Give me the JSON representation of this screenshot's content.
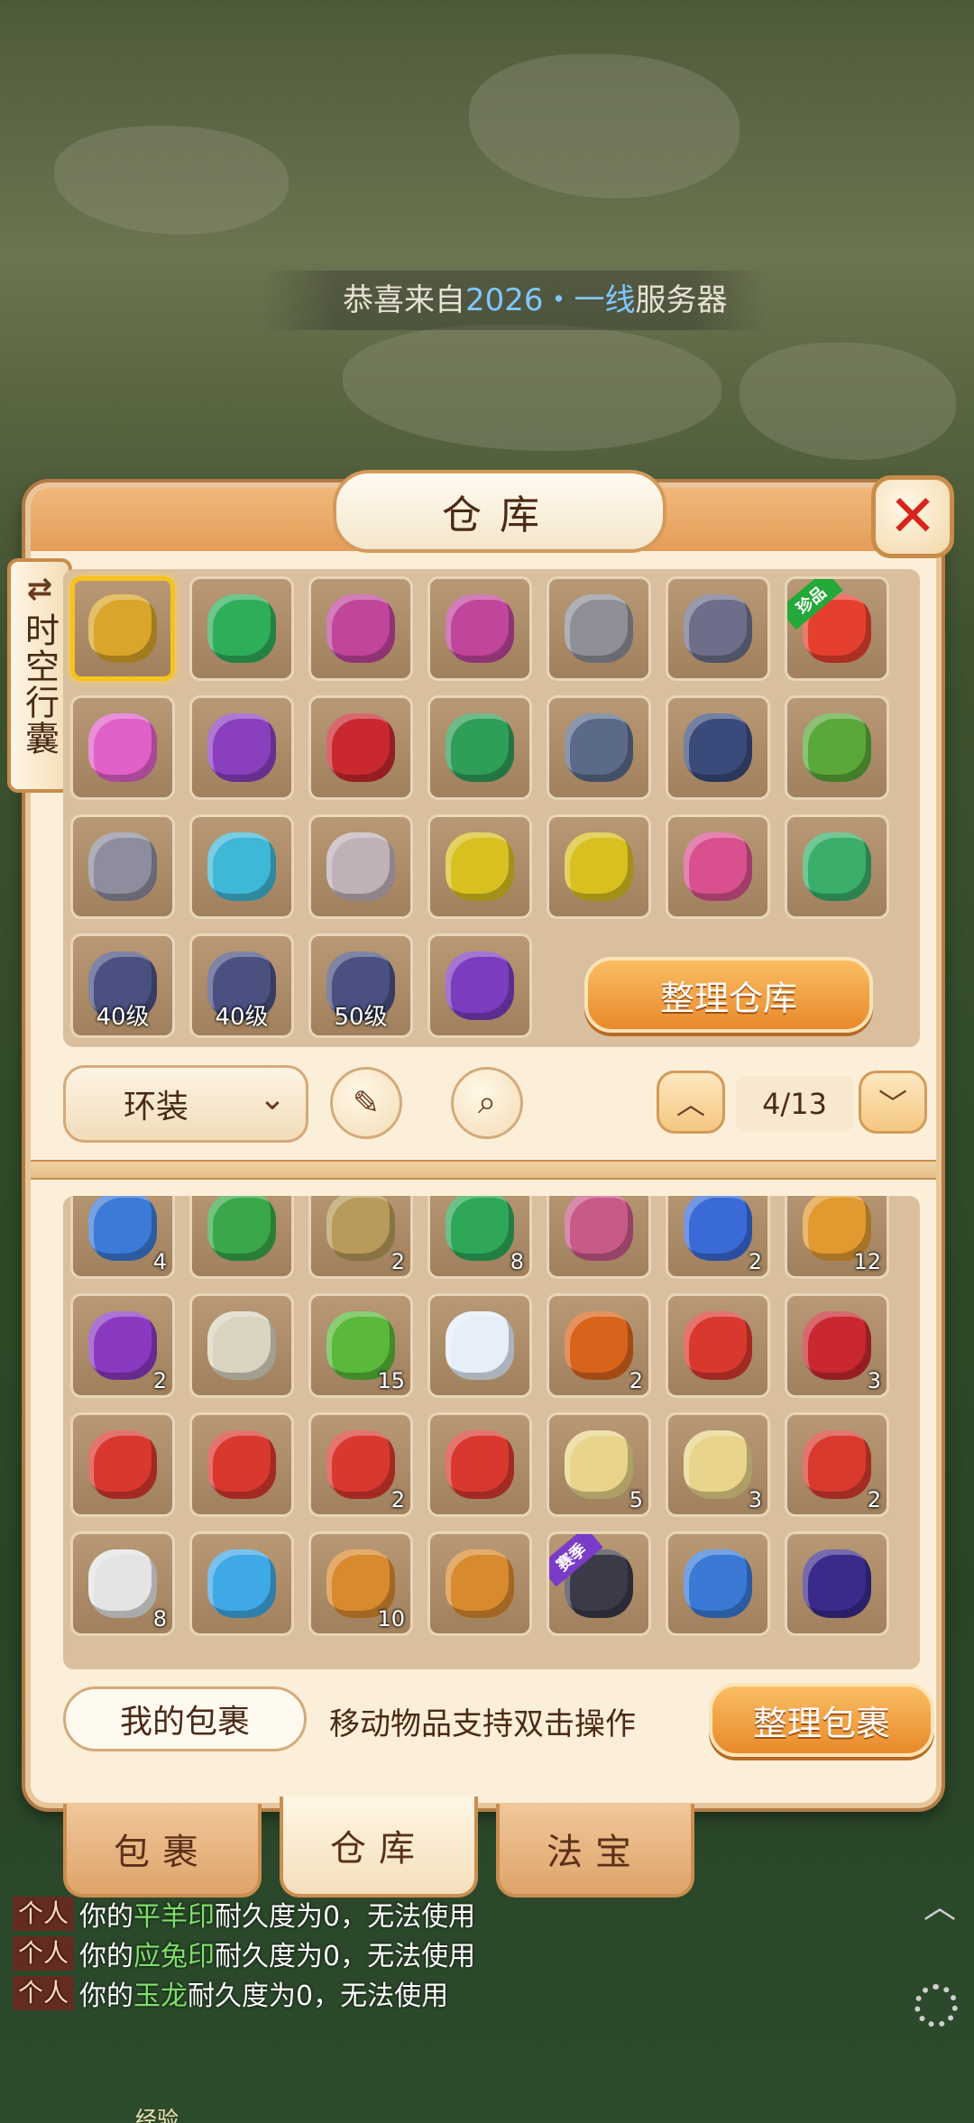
{
  "marquee": {
    "prefix": "恭喜来自",
    "highlight": "2026・一线",
    "suffix": "服务器"
  },
  "panel": {
    "title": "仓库",
    "close_glyph": "✕",
    "side_tab": {
      "icon": "⇄",
      "label": "时空行囊"
    }
  },
  "warehouse": {
    "items": [
      {
        "color": "#d9a52a",
        "selected": true
      },
      {
        "color": "#2fae5a"
      },
      {
        "color": "#c0459b"
      },
      {
        "color": "#c0459b"
      },
      {
        "color": "#8e8f98"
      },
      {
        "color": "#6d6f8a"
      },
      {
        "color": "#e5402e",
        "badge": "珍品"
      },
      {
        "color": "#e060c8"
      },
      {
        "color": "#8a3fbf"
      },
      {
        "color": "#c8282e"
      },
      {
        "color": "#2f9e58"
      },
      {
        "color": "#5a6a88"
      },
      {
        "color": "#3a4a7a"
      },
      {
        "color": "#5aa83a"
      },
      {
        "color": "#8d8d9d"
      },
      {
        "color": "#3fb7d6"
      },
      {
        "color": "#c0b0b8"
      },
      {
        "color": "#d8c020"
      },
      {
        "color": "#d8c020"
      },
      {
        "color": "#d8508e"
      },
      {
        "color": "#3aae6a"
      },
      {
        "color": "#4a5080",
        "level": "40级"
      },
      {
        "color": "#4a5080",
        "level": "40级"
      },
      {
        "color": "#4a5080",
        "level": "50级"
      },
      {
        "color": "#7b3cbf"
      }
    ],
    "sort_label": "整理仓库"
  },
  "toolbar": {
    "filter_value": "环装",
    "chevron_down": "⌄",
    "edit_icon": "✎",
    "search_icon": "⌕",
    "page_up": "︿",
    "page_down": "﹀",
    "page_value": "4/13"
  },
  "bag": {
    "items": [
      {
        "color": "#3b7ad6",
        "count": "4"
      },
      {
        "color": "#3aa84a"
      },
      {
        "color": "#b89a5a",
        "count": "2"
      },
      {
        "color": "#2ea858",
        "count": "8"
      },
      {
        "color": "#c85a8a"
      },
      {
        "color": "#3a6ad6",
        "count": "2"
      },
      {
        "color": "#e09a30",
        "count": "12"
      },
      {
        "color": "#8a3ac0",
        "count": "2"
      },
      {
        "color": "#d8d4c0"
      },
      {
        "color": "#5ab83a",
        "count": "15"
      },
      {
        "color": "#e6eef8"
      },
      {
        "color": "#d8641c",
        "count": "2"
      },
      {
        "color": "#d8382e"
      },
      {
        "color": "#c8282e",
        "count": "3"
      },
      {
        "color": "#d8382e"
      },
      {
        "color": "#d8382e"
      },
      {
        "color": "#d8382e",
        "count": "2"
      },
      {
        "color": "#d8382e"
      },
      {
        "color": "#e8d48a",
        "count": "5"
      },
      {
        "color": "#e8d48a",
        "count": "3"
      },
      {
        "color": "#d83a2e",
        "count": "2"
      },
      {
        "color": "#e4e4e4",
        "count": "8"
      },
      {
        "color": "#3fa8e6"
      },
      {
        "color": "#d88a2e",
        "count": "10"
      },
      {
        "color": "#d88a2e"
      },
      {
        "color": "#3a3a48",
        "badge": "赛季"
      },
      {
        "color": "#3a7ad6"
      },
      {
        "color": "#3a2a8a"
      }
    ],
    "label": "我的包裹",
    "hint": "移动物品支持双击操作",
    "sort_label": "整理包裹"
  },
  "tabs": [
    {
      "label": "包裹",
      "active": false
    },
    {
      "label": "仓库",
      "active": true
    },
    {
      "label": "法宝",
      "active": false
    }
  ],
  "log": [
    {
      "tag": "个人",
      "pre": "你的",
      "item": "平羊印",
      "post": "耐久度为0，无法使用"
    },
    {
      "tag": "个人",
      "pre": "你的",
      "item": "应兔印",
      "post": "耐久度为0，无法使用"
    },
    {
      "tag": "个人",
      "pre": "你的",
      "item": "玉龙",
      "post": "耐久度为0，无法使用"
    }
  ],
  "footer": {
    "exp_label": "经验"
  }
}
